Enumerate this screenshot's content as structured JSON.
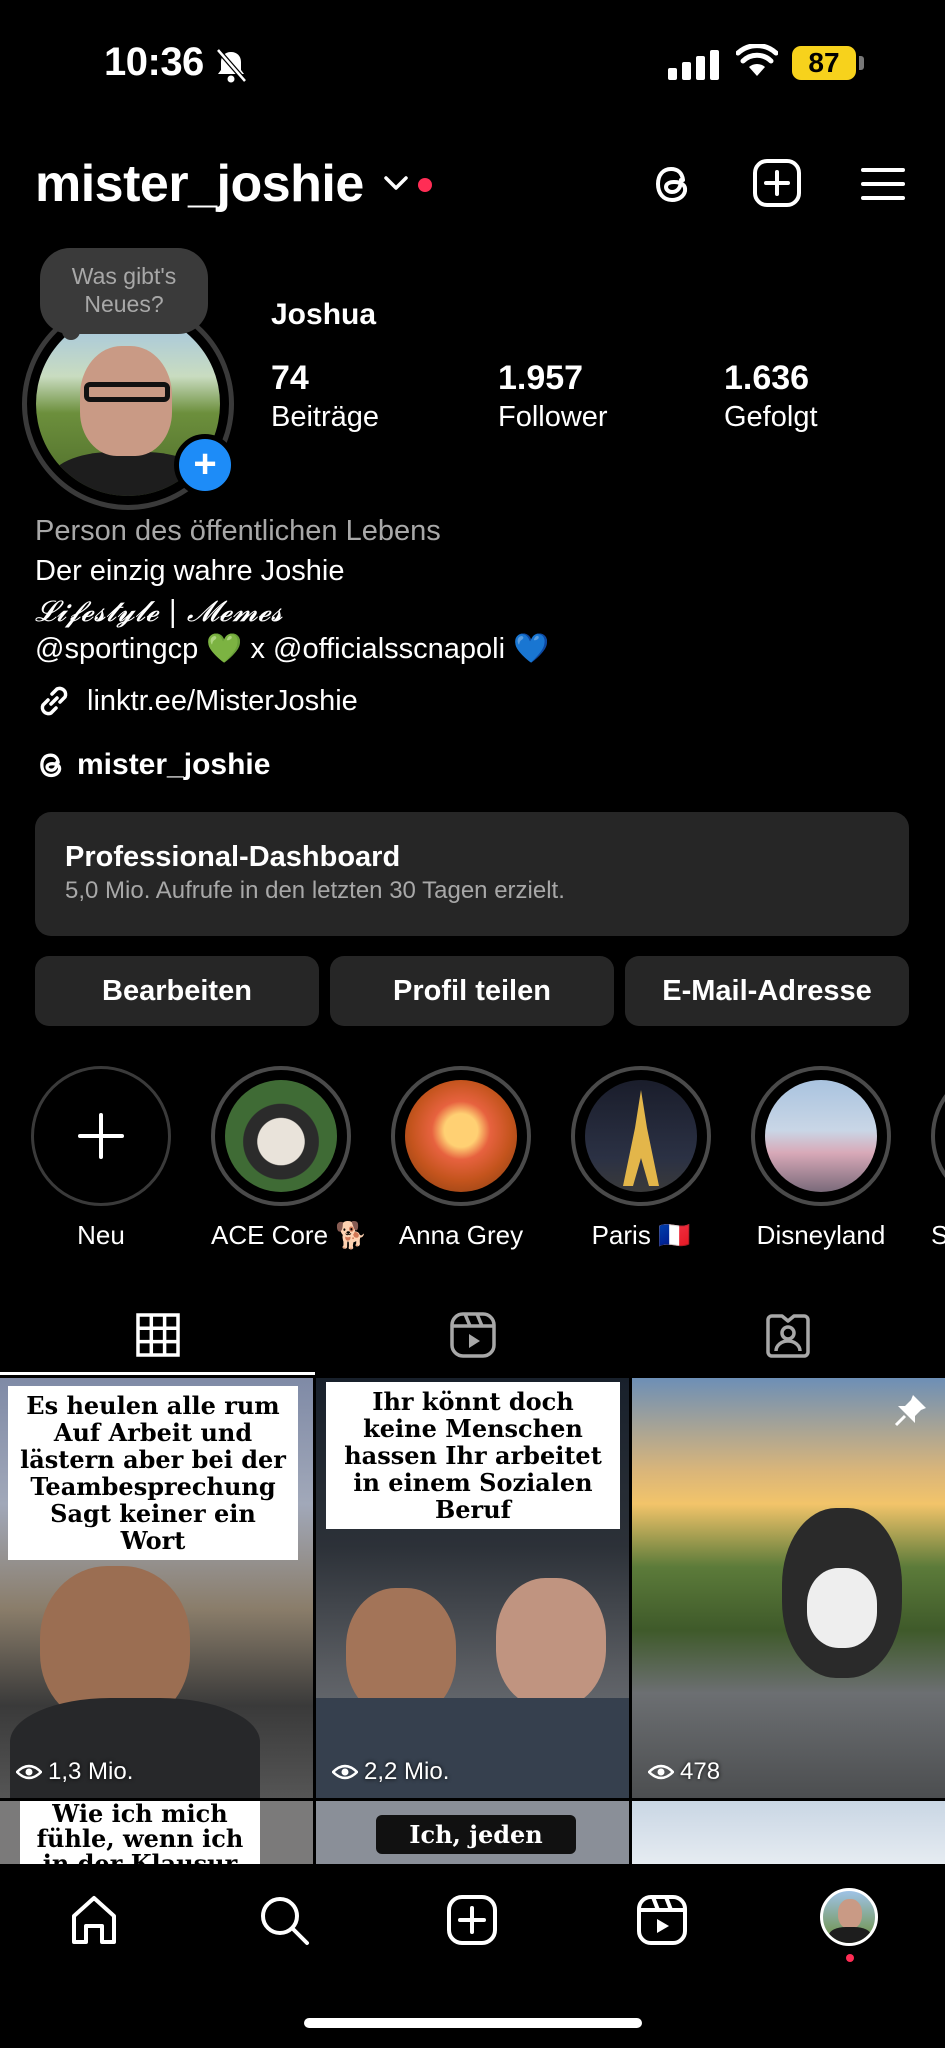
{
  "status_bar": {
    "time": "10:36",
    "battery": "87"
  },
  "header": {
    "username": "mister_joshie"
  },
  "profile": {
    "note": "Was gibt's Neues?",
    "name": "Joshua",
    "stats": [
      {
        "value": "74",
        "label": "Beiträge"
      },
      {
        "value": "1.957",
        "label": "Follower"
      },
      {
        "value": "1.636",
        "label": "Gefolgt"
      }
    ],
    "category": "Person des öffentlichen Lebens",
    "bio_lines": [
      "Der einzig wahre Joshie",
      "𝓛𝓲𝓯𝓮𝓼𝓽𝔂𝓵𝓮 | 𝓜𝓮𝓶𝓮𝓼",
      "@sportingcp 💚 x @officialsscnapoli 💙"
    ],
    "link": "linktr.ee/MisterJoshie",
    "threads_handle": "mister_joshie"
  },
  "dashboard": {
    "title": "Professional-Dashboard",
    "subtitle": "5,0 Mio. Aufrufe in den letzten 30 Tagen erzielt."
  },
  "actions": [
    "Bearbeiten",
    "Profil teilen",
    "E-Mail-Adresse"
  ],
  "highlights": [
    {
      "label": "Neu"
    },
    {
      "label": "ACE Core 🐕"
    },
    {
      "label": "Anna Grey"
    },
    {
      "label": "Paris 🇫🇷"
    },
    {
      "label": "Disneyland"
    },
    {
      "label": "S"
    }
  ],
  "posts": [
    {
      "caption": "Es heulen alle rum Auf Arbeit und lästern aber bei der Teambesprechung Sagt keiner ein Wort",
      "views": "1,3 Mio."
    },
    {
      "caption": "Ihr könnt doch keine Menschen hassen Ihr arbeitet in einem Sozialen Beruf",
      "views": "2,2 Mio."
    },
    {
      "caption": "",
      "views": "478"
    },
    {
      "caption": "Wie ich mich fühle, wenn ich in der Klausur",
      "views": ""
    },
    {
      "caption": "Ich, jeden",
      "views": ""
    },
    {
      "caption": "",
      "views": ""
    }
  ],
  "colors": {
    "accent_blue": "#1d8cf8",
    "notification_red": "#ff2d55",
    "battery": "#f7d21c",
    "surface": "#262626"
  }
}
